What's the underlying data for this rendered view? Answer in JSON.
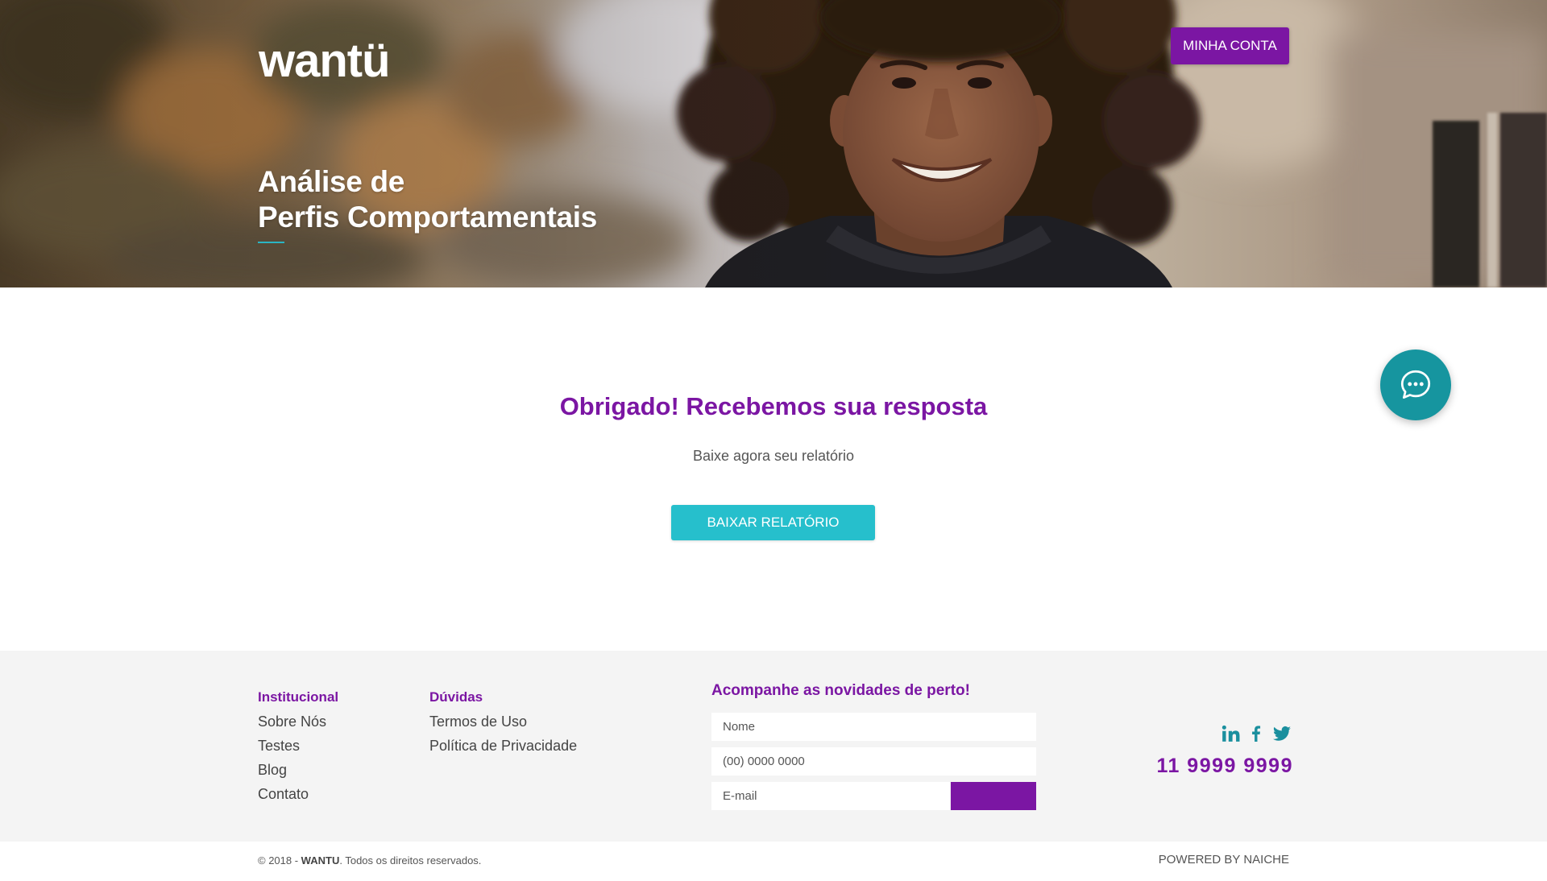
{
  "header": {
    "logo": "wantü",
    "account_button": "MINHA CONTA"
  },
  "hero": {
    "title_line1": "Análise de",
    "title_line2": "Perfis Comportamentais"
  },
  "main": {
    "heading": "Obrigado! Recebemos sua resposta",
    "subtitle": "Baixe agora seu relatório",
    "download_button": "BAIXAR RELATÓRIO"
  },
  "chat": {
    "icon": "chat-bubble-icon"
  },
  "footer": {
    "institucional": {
      "title": "Institucional",
      "links": [
        "Sobre Nós",
        "Testes",
        "Blog",
        "Contato"
      ]
    },
    "duvidas": {
      "title": "Dúvidas",
      "links": [
        "Termos de Uso",
        "Política de Privacidade"
      ]
    },
    "newsletter": {
      "title": "Acompanhe as novidades de perto!",
      "name_placeholder": "Nome",
      "phone_placeholder": "(00) 0000 0000",
      "email_placeholder": "E-mail"
    },
    "social_icons": [
      "linkedin-icon",
      "facebook-icon",
      "twitter-icon"
    ],
    "phone": "11 9999 9999"
  },
  "bottom": {
    "copyright_prefix": "© 2018 - ",
    "brand": "WANTU",
    "copyright_suffix": ". Todos os direitos reservados.",
    "powered_by": "POWERED BY NAICHE"
  },
  "colors": {
    "brand_purple": "#7b16a3",
    "accent_teal": "#26bfcc",
    "chat_teal": "#16959f",
    "social_teal": "#1a8f9e",
    "footer_bg": "#f4f4f4"
  }
}
